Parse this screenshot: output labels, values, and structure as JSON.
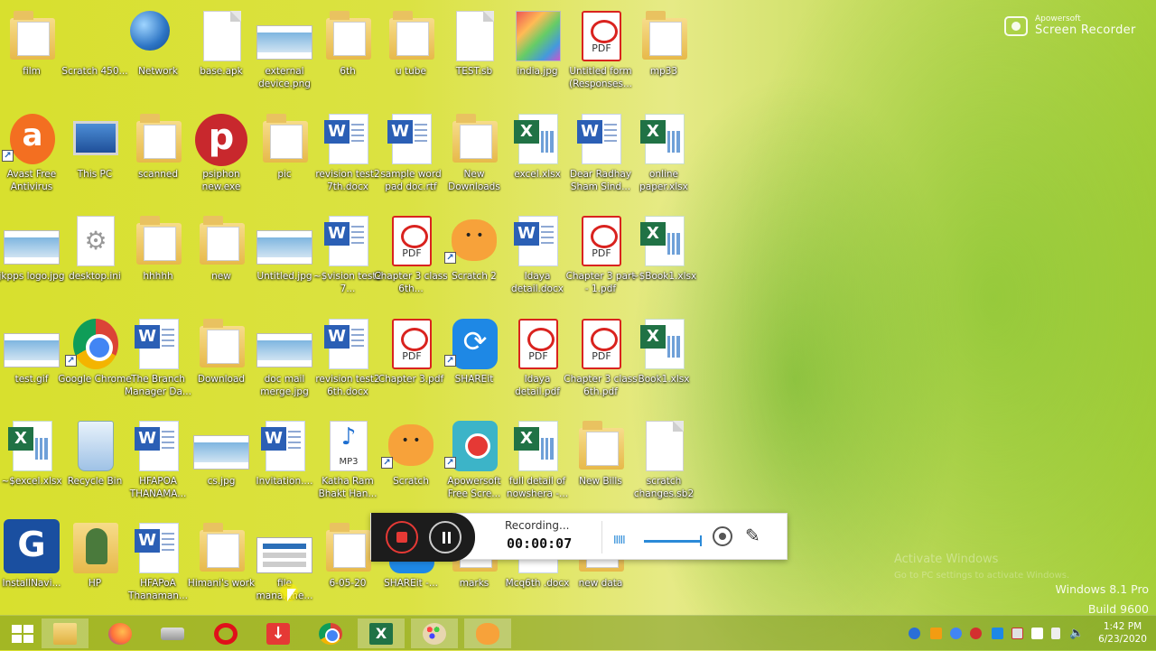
{
  "watermark": {
    "brand": "Apowersoft",
    "product": "Screen Recorder"
  },
  "desktop_icons": [
    {
      "label": "film",
      "kind": "folder"
    },
    {
      "label": "Scratch 450...",
      "kind": "box"
    },
    {
      "label": "Network",
      "kind": "globe"
    },
    {
      "label": "base.apk",
      "kind": "doc"
    },
    {
      "label": "external device.png",
      "kind": "photo"
    },
    {
      "label": "6th",
      "kind": "folder"
    },
    {
      "label": "u tube",
      "kind": "folder"
    },
    {
      "label": "TEST.sb",
      "kind": "doc"
    },
    {
      "label": "india.jpg",
      "kind": "map"
    },
    {
      "label": "Untitled form (Responses...",
      "kind": "pdf"
    },
    {
      "label": "mp33",
      "kind": "folder"
    },
    {
      "label": "Avast Free Antivirus",
      "kind": "avast",
      "shortcut": true
    },
    {
      "label": "This PC",
      "kind": "pc"
    },
    {
      "label": "scanned",
      "kind": "folder"
    },
    {
      "label": "psiphon new.exe",
      "kind": "psiphon"
    },
    {
      "label": "pic",
      "kind": "folder"
    },
    {
      "label": "revision test2 7th.docx",
      "kind": "word"
    },
    {
      "label": "sample word pad doc.rtf",
      "kind": "word"
    },
    {
      "label": "New Downloads",
      "kind": "folder"
    },
    {
      "label": "excel.xlsx",
      "kind": "excel"
    },
    {
      "label": "Dear Radhay Sham Sind...",
      "kind": "word"
    },
    {
      "label": "online paper.xlsx",
      "kind": "excel"
    },
    {
      "label": "jkpps logo.jpg",
      "kind": "photo"
    },
    {
      "label": "desktop.ini",
      "kind": "gear"
    },
    {
      "label": "hhhhh",
      "kind": "folder"
    },
    {
      "label": "new",
      "kind": "folder"
    },
    {
      "label": "Untitled.jpg",
      "kind": "photo"
    },
    {
      "label": "~$vision test2 7...",
      "kind": "word"
    },
    {
      "label": "Chapter 3 class 6th...",
      "kind": "pdf"
    },
    {
      "label": "Scratch 2",
      "kind": "scratch",
      "shortcut": true
    },
    {
      "label": "Idaya detail.docx",
      "kind": "word"
    },
    {
      "label": "Chapter 3 part - 1.pdf",
      "kind": "pdf"
    },
    {
      "label": "~$Book1.xlsx",
      "kind": "excel"
    },
    {
      "label": "test.gif",
      "kind": "photo"
    },
    {
      "label": "Google Chrome",
      "kind": "chrome",
      "shortcut": true
    },
    {
      "label": "The Branch Manager Da...",
      "kind": "word"
    },
    {
      "label": "Download",
      "kind": "folder"
    },
    {
      "label": "doc mail merge.jpg",
      "kind": "photo"
    },
    {
      "label": "revision test2 6th.docx",
      "kind": "word"
    },
    {
      "label": "Chapter 3.pdf",
      "kind": "pdf"
    },
    {
      "label": "SHAREit",
      "kind": "shareit",
      "shortcut": true
    },
    {
      "label": "Idaya detail.pdf",
      "kind": "pdf"
    },
    {
      "label": "Chapter 3 class 6th.pdf",
      "kind": "pdf"
    },
    {
      "label": "Book1.xlsx",
      "kind": "excel"
    },
    {
      "label": "~$excel.xlsx",
      "kind": "excel"
    },
    {
      "label": "Recycle Bin",
      "kind": "bin"
    },
    {
      "label": "HFAPOA THANAMA...",
      "kind": "word"
    },
    {
      "label": "cs.jpg",
      "kind": "photo"
    },
    {
      "label": "Invitation....",
      "kind": "word"
    },
    {
      "label": "Katha Ram Bhakt Han...",
      "kind": "mp3"
    },
    {
      "label": "Scratch",
      "kind": "scratch",
      "shortcut": true
    },
    {
      "label": "Apowersoft Free Scre...",
      "kind": "apower",
      "shortcut": true
    },
    {
      "label": "full detail of nowshera -...",
      "kind": "excel"
    },
    {
      "label": "New Bills",
      "kind": "folder"
    },
    {
      "label": "scratch changes.sb2",
      "kind": "doc"
    },
    {
      "label": "InstallNavi...",
      "kind": "installer"
    },
    {
      "label": "HP",
      "kind": "person"
    },
    {
      "label": "HFAPoA Thanaman...",
      "kind": "word"
    },
    {
      "label": "Himani's work",
      "kind": "folder"
    },
    {
      "label": "file mana...ne...",
      "kind": "cert"
    },
    {
      "label": "6-05-20",
      "kind": "folder"
    },
    {
      "label": "SHAREit -...",
      "kind": "shareit"
    },
    {
      "label": "marks",
      "kind": "folder"
    },
    {
      "label": "Mcq6th .docx",
      "kind": "word"
    },
    {
      "label": "new data",
      "kind": "folder"
    }
  ],
  "recorder": {
    "status": "Recording...",
    "time": "00:00:07",
    "audio_glyph": "IIIII"
  },
  "activation": {
    "line1": "Activate Windows",
    "line2": "Go to PC settings to activate Windows."
  },
  "os": {
    "edition": "Windows 8.1 Pro",
    "build": "Build 9600"
  },
  "taskbar": {
    "apps": [
      "start",
      "explorer",
      "firefox",
      "drive",
      "opera",
      "download",
      "chrome",
      "excel",
      "paint",
      "scratch"
    ]
  },
  "clock": {
    "time": "1:42 PM",
    "date": "6/23/2020"
  },
  "colors": {
    "accent": "#2b8ad8",
    "record": "#e53935"
  }
}
